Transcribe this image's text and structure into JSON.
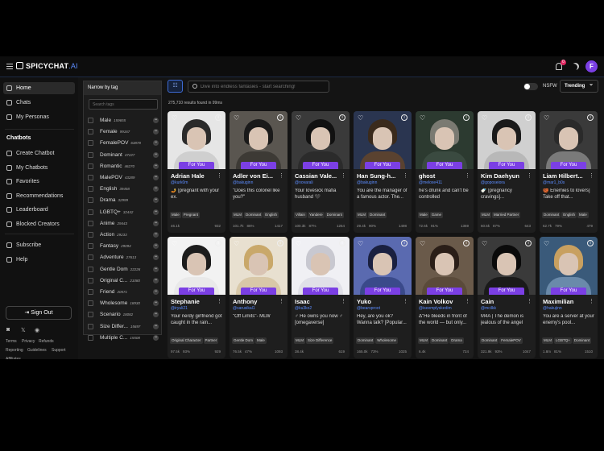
{
  "app": {
    "brand": "SPICYCHAT",
    "brand_suffix": ".AI",
    "notifications": "0",
    "avatar_letter": "F"
  },
  "sidebar": {
    "items": [
      {
        "label": "Home",
        "icon": "home-icon"
      },
      {
        "label": "Chats",
        "icon": "chat-icon"
      },
      {
        "label": "My Personas",
        "icon": "persona-icon"
      }
    ],
    "chatbots_title": "Chatbots",
    "chatbot_items": [
      {
        "label": "Create Chatbot",
        "icon": "create-icon"
      },
      {
        "label": "My Chatbots",
        "icon": "bot-icon"
      },
      {
        "label": "Favorites",
        "icon": "heart-icon"
      },
      {
        "label": "Recommendations",
        "icon": "recommend-icon"
      },
      {
        "label": "Leaderboard",
        "icon": "trophy-icon"
      },
      {
        "label": "Blocked Creators",
        "icon": "block-icon"
      }
    ],
    "extra_items": [
      {
        "label": "Subscribe",
        "icon": "subscribe-icon"
      },
      {
        "label": "Help",
        "icon": "help-icon"
      }
    ],
    "signout": "Sign Out",
    "footer_links": [
      "Terms",
      "Privacy",
      "Refunds",
      "Reporting",
      "Guidelines",
      "Support",
      "Affiliates"
    ]
  },
  "tagpanel": {
    "title": "Narrow by tag",
    "search_placeholder": "Search tags",
    "tags": [
      {
        "name": "Male",
        "count": "159655"
      },
      {
        "name": "Female",
        "count": "99167"
      },
      {
        "name": "FemalePOV",
        "count": "63878"
      },
      {
        "name": "Dominant",
        "count": "47227"
      },
      {
        "name": "Romantic",
        "count": "46270"
      },
      {
        "name": "MalePOV",
        "count": "43289"
      },
      {
        "name": "English",
        "count": "39458"
      },
      {
        "name": "Drama",
        "count": "32999"
      },
      {
        "name": "LGBTQ+",
        "count": "32442"
      },
      {
        "name": "Anime",
        "count": "29443"
      },
      {
        "name": "Action",
        "count": "29233"
      },
      {
        "name": "Fantasy",
        "count": "29094"
      },
      {
        "name": "Adventure",
        "count": "27613"
      },
      {
        "name": "Gentle Dom",
        "count": "22226"
      },
      {
        "name": "Original C...",
        "count": "21080"
      },
      {
        "name": "Friend",
        "count": "20571"
      },
      {
        "name": "Wholesome",
        "count": "18930"
      },
      {
        "name": "Scenario",
        "count": "18082"
      },
      {
        "name": "Size Differ...",
        "count": "15697"
      },
      {
        "name": "Multiple C...",
        "count": "15508"
      }
    ]
  },
  "toolbar": {
    "search_placeholder": "Dive into endless fantasies - start searching!",
    "results": "275,710 results found in 99ms",
    "nsfw_label": "NSFW",
    "sort": "Trending"
  },
  "cards": [
    {
      "name": "Adrian Hale",
      "handle": "@kurk0m",
      "badge": "For You",
      "desc": "🤳 [pregnant with your ex.",
      "tags": [
        "Male",
        "Pregnant",
        "Original Character"
      ],
      "stats": [
        "46.1k",
        "",
        "932"
      ],
      "palette": [
        "#cfcfcf",
        "#2a2a2a",
        "#e6e6e6"
      ]
    },
    {
      "name": "Adler von Ei...",
      "handle": "@bakuginn",
      "badge": "For You",
      "desc": "\"Does this colonel like you?\"",
      "tags": [
        "MLM",
        "Dominant",
        "English",
        "FemalePOV"
      ],
      "stats": [
        "101.7k",
        "86%",
        "1417"
      ],
      "palette": [
        "#3d3a35",
        "#1a1a1a",
        "#5a5650"
      ]
    },
    {
      "name": "Cassian Vale...",
      "handle": "@novarali",
      "badge": "For You",
      "desc": "Your lovesick mafia husband 🖤",
      "tags": [
        "Villain",
        "Yandere",
        "Dominant",
        "Gentle Dom"
      ],
      "stats": [
        "100.3k",
        "87%",
        "1264"
      ],
      "palette": [
        "#2b2b2b",
        "#111111",
        "#3a3a3a"
      ]
    },
    {
      "name": "Han Sung-h...",
      "handle": "@bakuginn",
      "badge": "For You",
      "desc": "You are the manager of a famous actor. The...",
      "tags": [
        "MLM",
        "Dominant",
        "FemalePOV",
        "LGBTQ+"
      ],
      "stats": [
        "29.4k",
        "90%",
        "1498"
      ],
      "palette": [
        "#5a4230",
        "#3a2a1c",
        "#2a3550"
      ]
    },
    {
      "name": "ghost",
      "handle": "@meloxe411",
      "badge": "For You",
      "desc": "he's drunk and can't be controlled",
      "tags": [
        "Male",
        "Game"
      ],
      "stats": [
        "72.6k",
        "91%",
        "1369"
      ],
      "palette": [
        "#3a4a40",
        "#7a7a72",
        "#2c3a30"
      ]
    },
    {
      "name": "Kim Daehyun",
      "handle": "@goposeiora",
      "badge": "For You",
      "desc": "🍼 [pregnancy cravings]...",
      "tags": [
        "MLM",
        "Married Partner",
        "Drama",
        "FemalePOV"
      ],
      "stats": [
        "60.5k",
        "87%",
        "643"
      ],
      "palette": [
        "#b8b8b8",
        "#1a1a1a",
        "#d0d0d0"
      ]
    },
    {
      "name": "Liam Hilbert...",
      "handle": "@mar1_b0s",
      "badge": "For You",
      "desc": "🏀 Enemies to lovers] Take off that...",
      "tags": [
        "Dominant",
        "English",
        "Male"
      ],
      "stats": [
        "62.7k",
        "79%",
        "479"
      ],
      "palette": [
        "#7a7a7a",
        "#2a2a2a",
        "#3a3a3a"
      ]
    },
    {
      "name": "Stephanie",
      "handle": "@iryuli21",
      "badge": "For You",
      "desc": "Your nerdy girlfriend got caught in the rain...",
      "tags": [
        "Original Character",
        "Partner",
        "LGBTQ+"
      ],
      "stats": [
        "97.5k",
        "93%",
        "929"
      ],
      "palette": [
        "#e9e9e9",
        "#1c1c1c",
        "#f2f2f2"
      ]
    },
    {
      "name": "Anthony",
      "handle": "@sarusikal1",
      "badge": "For You",
      "desc": "\"Off Limits\"- MLW",
      "tags": [
        "Gentle Dom",
        "Male",
        "MalePOV"
      ],
      "stats": [
        "76.5k",
        "47%",
        "1093"
      ],
      "palette": [
        "#d8c8a8",
        "#c9a86a",
        "#e8e0d0"
      ]
    },
    {
      "name": "Isaac",
      "handle": "@ku3ko2",
      "badge": "For You",
      "desc": "♂ He owns you now ♂ [omegaverse]",
      "tags": [
        "MLM",
        "Size Difference",
        "Dominant",
        "English"
      ],
      "stats": [
        "38.4k",
        "",
        "619"
      ],
      "palette": [
        "#e0e0e8",
        "#c8c8d0",
        "#f0f0f4"
      ]
    },
    {
      "name": "Yuko",
      "handle": "@bearsproot",
      "badge": "For You",
      "desc": "Hey, are you ok? Wanna talk? [Popular...",
      "tags": [
        "Dominant",
        "Wholesome",
        "Female",
        "MalePOV"
      ],
      "stats": [
        "165.0k",
        "73%",
        "1025"
      ],
      "palette": [
        "#3a4a8a",
        "#1a2040",
        "#5a6ab0"
      ]
    },
    {
      "name": "Kain Volkov",
      "handle": "@iseemplyskedim",
      "badge": "For You",
      "desc": "Δ\"He bleeds in front of the world — but only...",
      "tags": [
        "MLM",
        "Dominant",
        "Drama",
        "English"
      ],
      "stats": [
        "6.4k",
        "",
        "724"
      ],
      "palette": [
        "#5a4a3a",
        "#2a1e18",
        "#6a5a4a"
      ]
    },
    {
      "name": "Cain",
      "handle": "@mcilkk",
      "badge": "For You",
      "desc": "M4A | The demon is jealous of the angel",
      "tags": [
        "Dominant",
        "FemalePOV",
        "MalePOV",
        "Male"
      ],
      "stats": [
        "321.9k",
        "93%",
        "1047"
      ],
      "palette": [
        "#1a1a1a",
        "#0a0a0a",
        "#3a3a3a"
      ]
    },
    {
      "name": "Maximilian",
      "handle": "@hakujinn",
      "badge": "For You",
      "desc": "You are a server at your enemy's pool...",
      "tags": [
        "MLM",
        "LGBTQ+",
        "Dominant",
        "English"
      ],
      "stats": [
        "1.8m",
        "81%",
        "1510"
      ],
      "palette": [
        "#6a8aaa",
        "#c8a060",
        "#3a5a7a"
      ]
    }
  ]
}
